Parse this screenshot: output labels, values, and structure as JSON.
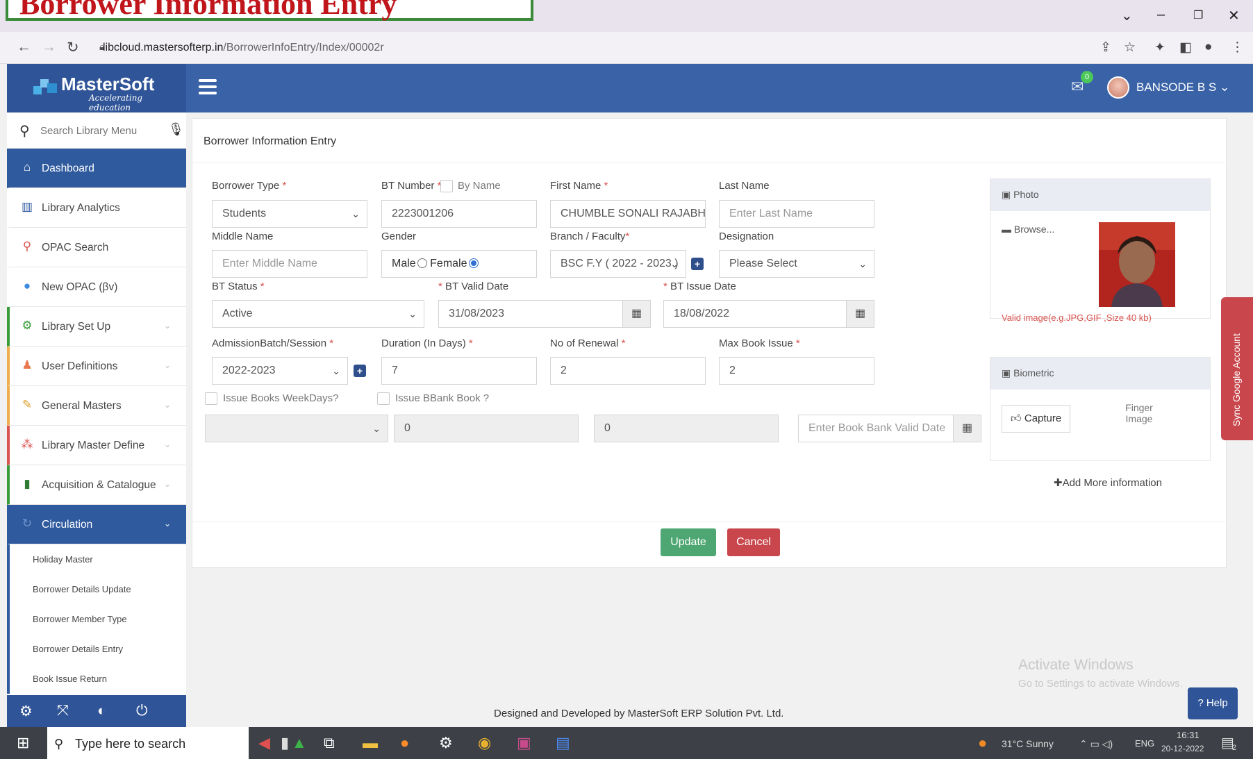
{
  "caption": "Borrower Information Entry",
  "browser": {
    "url_host": "libcloud.mastersofterp.in",
    "url_path": "/BorrowerInfoEntry/Index/00002r"
  },
  "header": {
    "brand_name": "MasterSoft",
    "brand_tagline": "Accelerating education",
    "mail_badge": "0",
    "user_name": "BANSODE B S"
  },
  "sidebar": {
    "search_placeholder": "Search Library Menu",
    "items": [
      {
        "label": "Dashboard",
        "icon": "home-icon"
      },
      {
        "label": "Library Analytics",
        "icon": "bar-chart-icon"
      },
      {
        "label": "OPAC Search",
        "icon": "search-icon"
      },
      {
        "label": "New OPAC (βv)",
        "icon": "globe-icon"
      },
      {
        "label": "Library Set Up",
        "icon": "cogs-icon"
      },
      {
        "label": "User Definitions",
        "icon": "users-icon"
      },
      {
        "label": "General Masters",
        "icon": "edit-icon"
      },
      {
        "label": "Library Master Define",
        "icon": "sitemap-icon"
      },
      {
        "label": "Acquisition & Catalogue",
        "icon": "book-icon"
      },
      {
        "label": "Circulation",
        "icon": "refresh-icon"
      }
    ],
    "sub_items": [
      "Holiday Master",
      "Borrower Details Update",
      "Borrower Member Type",
      "Borrower Details Entry",
      "Book Issue Return"
    ]
  },
  "form": {
    "title": "Borrower Information Entry",
    "borrower_type_label": "Borrower Type",
    "borrower_type_value": "Students",
    "bt_number_label": "BT Number",
    "by_name_label": "By Name",
    "bt_number_value": "2223001206",
    "first_name_label": "First Name",
    "first_name_value": "CHUMBLE  SONALI  RAJABHAU",
    "last_name_label": "Last Name",
    "last_name_placeholder": "Enter Last Name",
    "middle_name_label": "Middle Name",
    "middle_name_placeholder": "Enter Middle Name",
    "gender_label": "Gender",
    "gender_male": "Male",
    "gender_female": "Female",
    "branch_label": "Branch / Faculty",
    "branch_value": "BSC F.Y ( 2022 - 2023 )",
    "designation_label": "Designation",
    "designation_value": "Please Select",
    "bt_status_label": "BT Status",
    "bt_status_value": "Active",
    "bt_valid_label": "BT Valid Date",
    "bt_valid_value": "31/08/2023",
    "bt_issue_label": "BT Issue Date",
    "bt_issue_value": "18/08/2022",
    "admission_label": "AdmissionBatch/Session",
    "admission_value": "2022-2023",
    "duration_label": "Duration (In Days)",
    "duration_value": "7",
    "renewal_label": "No of Renewal",
    "renewal_value": "2",
    "max_issue_label": "Max Book Issue",
    "max_issue_value": "2",
    "weekdays_label": "Issue Books WeekDays?",
    "bbank_label": "Issue BBank Book ?",
    "bbank_value1": "0",
    "bbank_value2": "0",
    "bbank_date_placeholder": "Enter Book Bank Valid Date",
    "photo_title": "Photo",
    "browse_label": "Browse...",
    "photo_hint": "Valid image(e.g.JPG,GIF ,Size 40 kb)",
    "biometric_title": "Biometric",
    "capture_label": "Capture",
    "finger_image_alt": "Finger Image",
    "add_more": "Add More information",
    "update_label": "Update",
    "cancel_label": "Cancel"
  },
  "footer": {
    "credit": "Designed and Developed by MasterSoft ERP Solution Pvt. Ltd.",
    "help_label": "Help",
    "sync_label": "Sync Google Account"
  },
  "watermark": {
    "line1": "Activate Windows",
    "line2": "Go to Settings to activate Windows."
  },
  "taskbar": {
    "search_placeholder": "Type here to search",
    "weather": "31°C  Sunny",
    "lang": "ENG",
    "time": "16:31",
    "date": "20-12-2022",
    "notif_count": "2"
  },
  "colors": {
    "header": "#3a63a7",
    "sidebar_active": "#2f5a9e",
    "update": "#4ea772",
    "cancel": "#c9474c"
  }
}
